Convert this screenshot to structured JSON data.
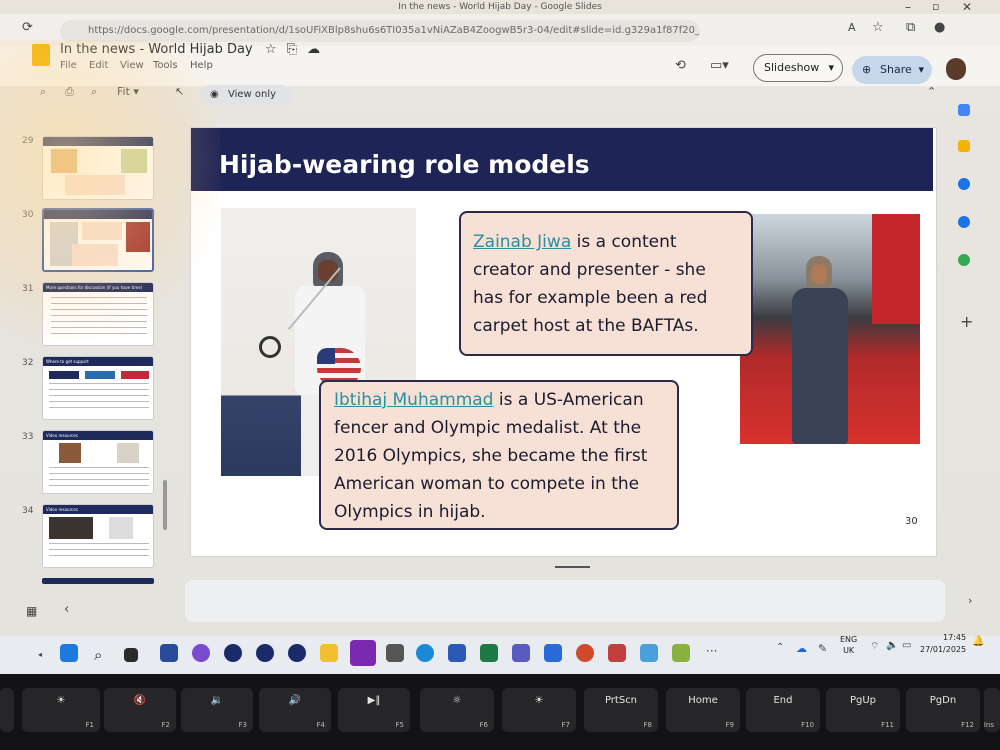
{
  "window": {
    "title": "In the news - World Hijab Day - Google Slides"
  },
  "browser": {
    "url": "https://docs.google.com/presentation/d/1soUFiXBlp8shu6s6TI035a1vNiAZaB4ZoogwB5r3-04/edit#slide=id.g329a1f87f20_0_55"
  },
  "doc": {
    "title": "In the news - World Hijab Day",
    "menu": [
      "File",
      "Edit",
      "View",
      "Tools",
      "Help"
    ],
    "slideshow_label": "Slideshow",
    "share_label": "Share",
    "zoom_label": "Fit",
    "view_only_label": "View only"
  },
  "filmstrip": [
    {
      "num": "29",
      "title": ""
    },
    {
      "num": "30",
      "title": "",
      "selected": true
    },
    {
      "num": "31",
      "title": "More questions for discussion (if you have time)"
    },
    {
      "num": "32",
      "title": "Where to get support"
    },
    {
      "num": "33",
      "title": "Video resources"
    },
    {
      "num": "34",
      "title": "Video resources"
    }
  ],
  "slide": {
    "heading": "Hijab-wearing role models",
    "card1": {
      "link": "Zainab Jiwa",
      "text": " is a content creator and presenter - she has for example been a red carpet host at the BAFTAs."
    },
    "card2": {
      "link": "Ibtihaj Muhammad",
      "text": " is a US-American fencer and Olympic medalist. At the 2016 Olympics, she became the first American woman to compete in the Olympics in hijab."
    },
    "page_number": "30"
  },
  "taskbar": {
    "lang1": "ENG",
    "lang2": "UK",
    "time": "17:45",
    "date": "27/01/2025"
  },
  "keyboard": [
    {
      "label": "☀",
      "fn": "F1"
    },
    {
      "label": "🔇",
      "fn": "F2"
    },
    {
      "label": "🔉",
      "fn": "F3"
    },
    {
      "label": "🔊",
      "fn": "F4"
    },
    {
      "label": "▶‖",
      "fn": "F5"
    },
    {
      "label": "☼",
      "fn": "F6"
    },
    {
      "label": "☀",
      "fn": "F7"
    },
    {
      "label": "PrtScn",
      "fn": "F8"
    },
    {
      "label": "Home",
      "fn": "F9"
    },
    {
      "label": "End",
      "fn": "F10"
    },
    {
      "label": "PgUp",
      "fn": "F11"
    },
    {
      "label": "PgDn",
      "fn": "F12"
    },
    {
      "label": "",
      "fn": "Ins"
    }
  ],
  "colors": {
    "banner": "#1e2456",
    "card": "#f7e0d6",
    "link": "#2a8fa0",
    "share": "#c6d7ec"
  }
}
